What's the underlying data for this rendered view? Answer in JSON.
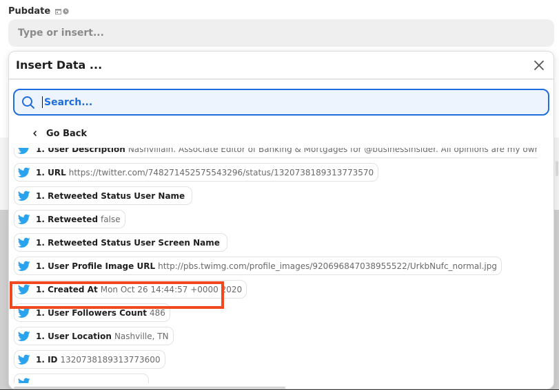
{
  "field": {
    "label": "Pubdate",
    "icons": [
      "calendar-icon",
      "clock-icon"
    ],
    "placeholder": "Type or insert..."
  },
  "modal": {
    "title": "Insert Data ...",
    "close_icon": "close-icon",
    "search": {
      "placeholder": "Search...",
      "value": ""
    },
    "go_back_label": "Go Back"
  },
  "items": [
    {
      "key": "1. User Description",
      "value": "Nashvillain. Associate Editor of Banking & Mortgages for @businessinsider. All opinions are my own.",
      "icon": "twitter-icon"
    },
    {
      "key": "1. URL",
      "value": "https://twitter.com/748271452575543296/status/1320738189313773570",
      "icon": "twitter-icon"
    },
    {
      "key": "1. Retweeted Status User Name",
      "value": "",
      "icon": "twitter-icon"
    },
    {
      "key": "1. Retweeted",
      "value": "false",
      "icon": "twitter-icon"
    },
    {
      "key": "1. Retweeted Status User Screen Name",
      "value": "",
      "icon": "twitter-icon"
    },
    {
      "key": "1. User Profile Image URL",
      "value": "http://pbs.twimg.com/profile_images/920696847038955522/UrkbNufc_normal.jpg",
      "icon": "twitter-icon"
    },
    {
      "key": "1. Created At",
      "value": "Mon Oct 26 14:44:57 +0000 2020",
      "icon": "twitter-icon",
      "highlighted": true
    },
    {
      "key": "1. User Followers Count",
      "value": "486",
      "icon": "twitter-icon"
    },
    {
      "key": "1. User Location",
      "value": "Nashville, TN",
      "icon": "twitter-icon"
    },
    {
      "key": "1. ID",
      "value": "1320738189313773600",
      "icon": "twitter-icon"
    },
    {
      "key": "",
      "value": "",
      "icon": "twitter-icon"
    }
  ],
  "colors": {
    "accent": "#1f6ddb",
    "twitter": "#2aa3ef",
    "highlight": "#f0481f"
  }
}
